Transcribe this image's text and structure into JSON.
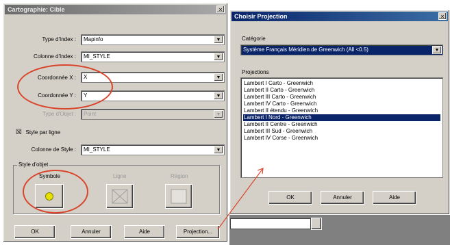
{
  "left_dialog": {
    "title": "Cartographie: Cible",
    "close": "×",
    "fields": [
      {
        "label": "Type d'Index :",
        "value": "Mapinfo"
      },
      {
        "label": "Colonne d'Index :",
        "value": "MI_STYLE"
      },
      {
        "label": "Coordonnée X :",
        "value": "X"
      },
      {
        "label": "Coordonnée Y :",
        "value": "Y"
      },
      {
        "label": "Type d'Objet :",
        "value": "Point"
      }
    ],
    "style_checkbox_label": "Style par ligne",
    "style_checkbox_mark": "☒",
    "style_column_label": "Colonne de Style :",
    "style_column_value": "MI_STYLE",
    "group_label": "Style d'objet",
    "style_buttons": [
      {
        "label": "Symbole"
      },
      {
        "label": "Ligne"
      },
      {
        "label": "Région"
      }
    ],
    "buttons": {
      "ok": "OK",
      "cancel": "Annuler",
      "help": "Aide",
      "projection": "Projection..."
    }
  },
  "right_dialog": {
    "title": "Choisir Projection",
    "close": "×",
    "category_label": "Catégorie",
    "category_value": "Système Français Méridien de Greenwich (All <0.5)",
    "projections_label": "Projections",
    "projections": [
      "Lambert I Carto - Greenwich",
      "Lambert II Carto - Greenwich",
      "Lambert III Carto - Greenwich",
      "Lambert IV Carto - Greenwich",
      "Lambert II étendu - Greenwich",
      "Lambert I Nord - Greenwich",
      "Lambert II Centre - Greenwich",
      "Lambert III Sud - Greenwich",
      "Lambert IV Corse - Greenwich"
    ],
    "selected_projection": "Lambert I Nord - Greenwich",
    "buttons": {
      "ok": "OK",
      "cancel": "Annuler",
      "help": "Aide"
    }
  },
  "colors": {
    "annotation_red": "#d9452b",
    "selection_blue": "#0a246a",
    "dialog_face": "#d4d0c8"
  }
}
